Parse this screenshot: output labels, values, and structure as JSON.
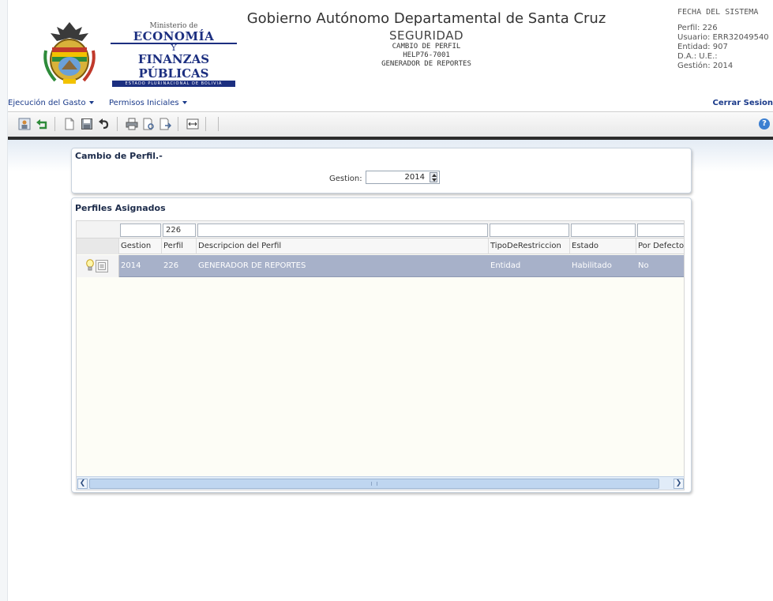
{
  "header": {
    "ministry_small": "Ministerio de",
    "ministry_line1": "ECONOMÍA",
    "ministry_y": "Y",
    "ministry_line2": "FINANZAS PÚBLICAS",
    "ministry_band": "ESTADO PLURINACIONAL DE BOLIVIA",
    "title": "Gobierno Autónomo Departamental de Santa Cruz",
    "subtitle": "SEGURIDAD",
    "line1": "CAMBIO DE PERFIL",
    "line2": "HELP76-7001",
    "line3": "GENERADOR DE REPORTES"
  },
  "system": {
    "title": "FECHA DEL SISTEMA",
    "perfil": "Perfil: 226",
    "usuario": "Usuario: ERR32049540",
    "entidad": "Entidad: 907",
    "da_ue": "D.A.:  U.E.:",
    "gestion": "Gestión: 2014"
  },
  "menu": {
    "items": [
      "Ejecución del Gasto",
      "Permisos Iniciales"
    ],
    "logout": "Cerrar Sesion"
  },
  "toolbar": {
    "icons": [
      "user-card-icon",
      "back-icon",
      "new-document-icon",
      "save-icon",
      "undo-icon",
      "print-icon",
      "preview-icon",
      "export-icon",
      "fit-width-icon"
    ],
    "help": "?"
  },
  "cambio_perfil": {
    "title": "Cambio de Perfil.-",
    "gestion_label": "Gestion:",
    "gestion_value": "2014"
  },
  "perfiles": {
    "title": "Perfiles Asignados",
    "filters": [
      "",
      "226",
      "",
      "",
      "",
      ""
    ],
    "columns": [
      "Gestion",
      "Perfil",
      "Descripcion del Perfil",
      "TipoDeRestriccion",
      "Estado",
      "Por Defecto"
    ],
    "rows": [
      [
        "2014",
        "226",
        "GENERADOR DE REPORTES",
        "Entidad",
        "Habilitado",
        "No"
      ]
    ]
  },
  "colors": {
    "brand_blue": "#1c2f80",
    "selected_row": "#a7b1c9",
    "link": "#1a3a8a"
  }
}
